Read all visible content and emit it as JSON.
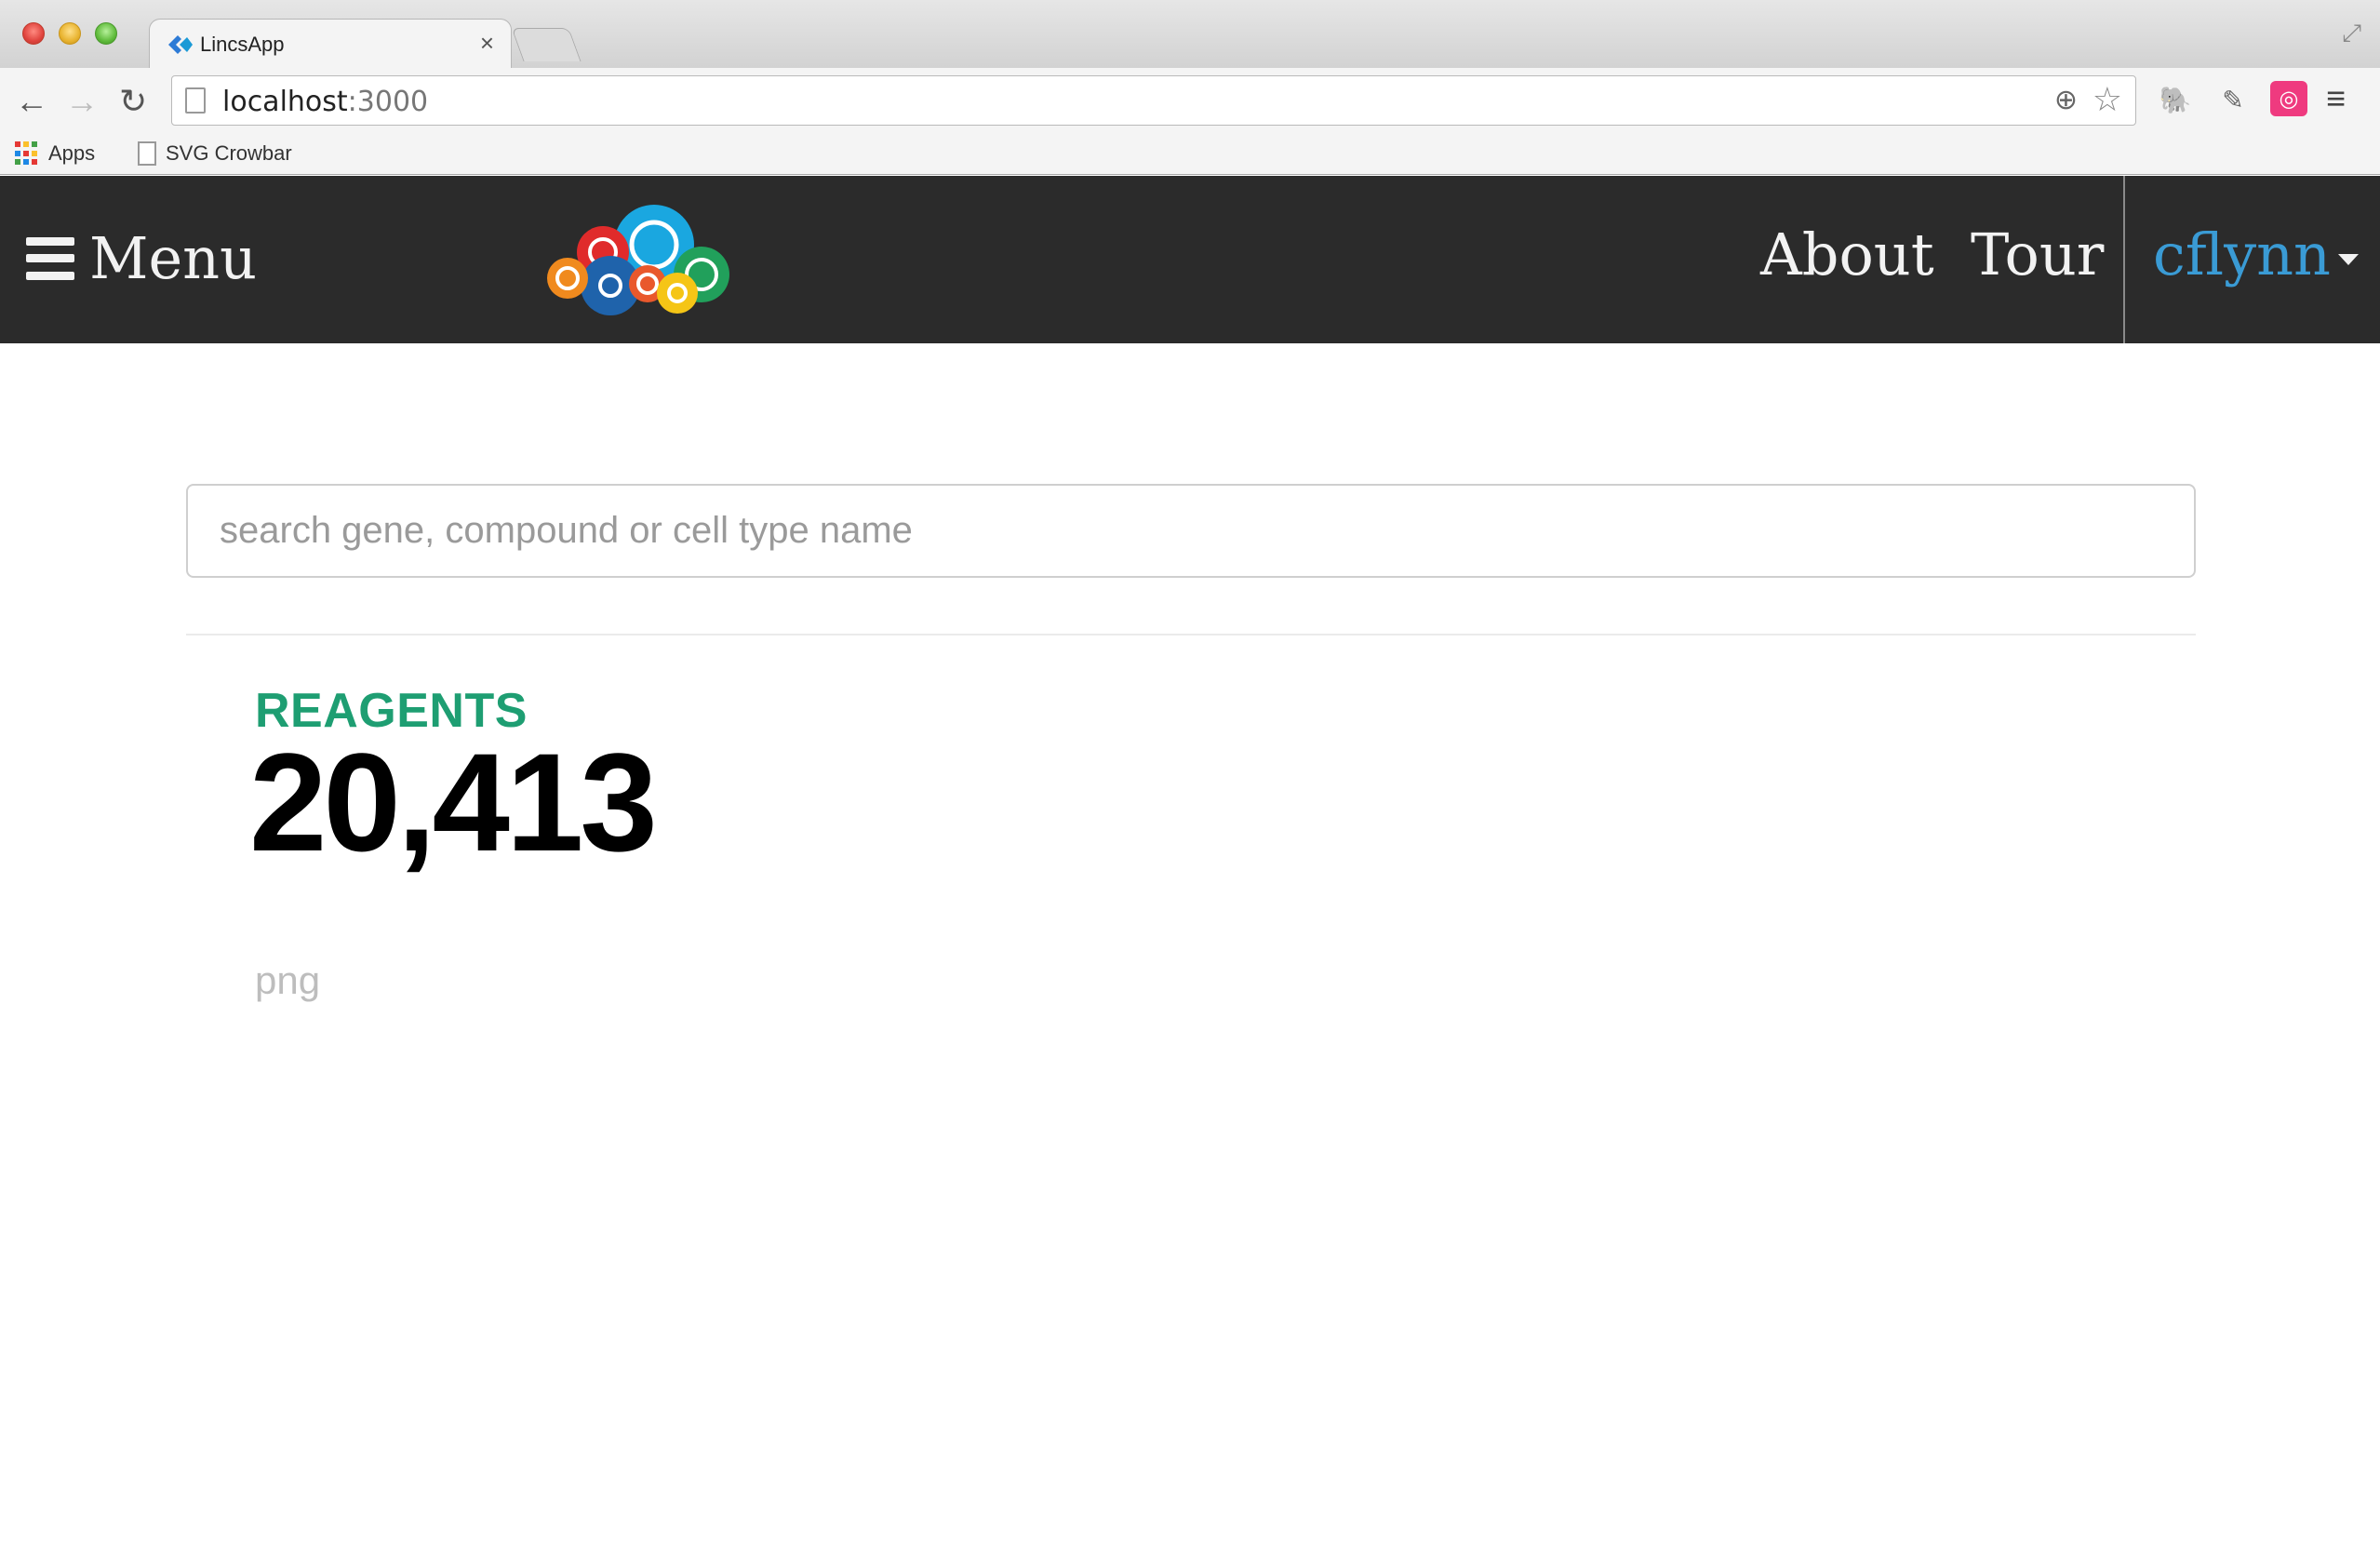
{
  "browser": {
    "tab_title": "LincsApp",
    "tab_close": "×",
    "url_host": "localhost",
    "url_port": ":3000",
    "bookmarks": [
      {
        "label": "Apps",
        "icon": "apps-grid-icon"
      },
      {
        "label": "SVG Crowbar",
        "icon": "page-icon"
      }
    ]
  },
  "navbar": {
    "menu_label": "Menu",
    "links": {
      "about": "About",
      "tour": "Tour"
    },
    "user": "cflynn",
    "logo": "lincs-bubbles-logo",
    "colors": {
      "background": "#2b2b2b",
      "text": "#f2f2f2",
      "user": "#3a9bd5"
    }
  },
  "search": {
    "placeholder": "search gene, compound or cell type name",
    "value": ""
  },
  "stats": {
    "label": "REAGENTS",
    "count": "20,413",
    "label_color": "#1e9e72"
  },
  "footer_text": "png"
}
